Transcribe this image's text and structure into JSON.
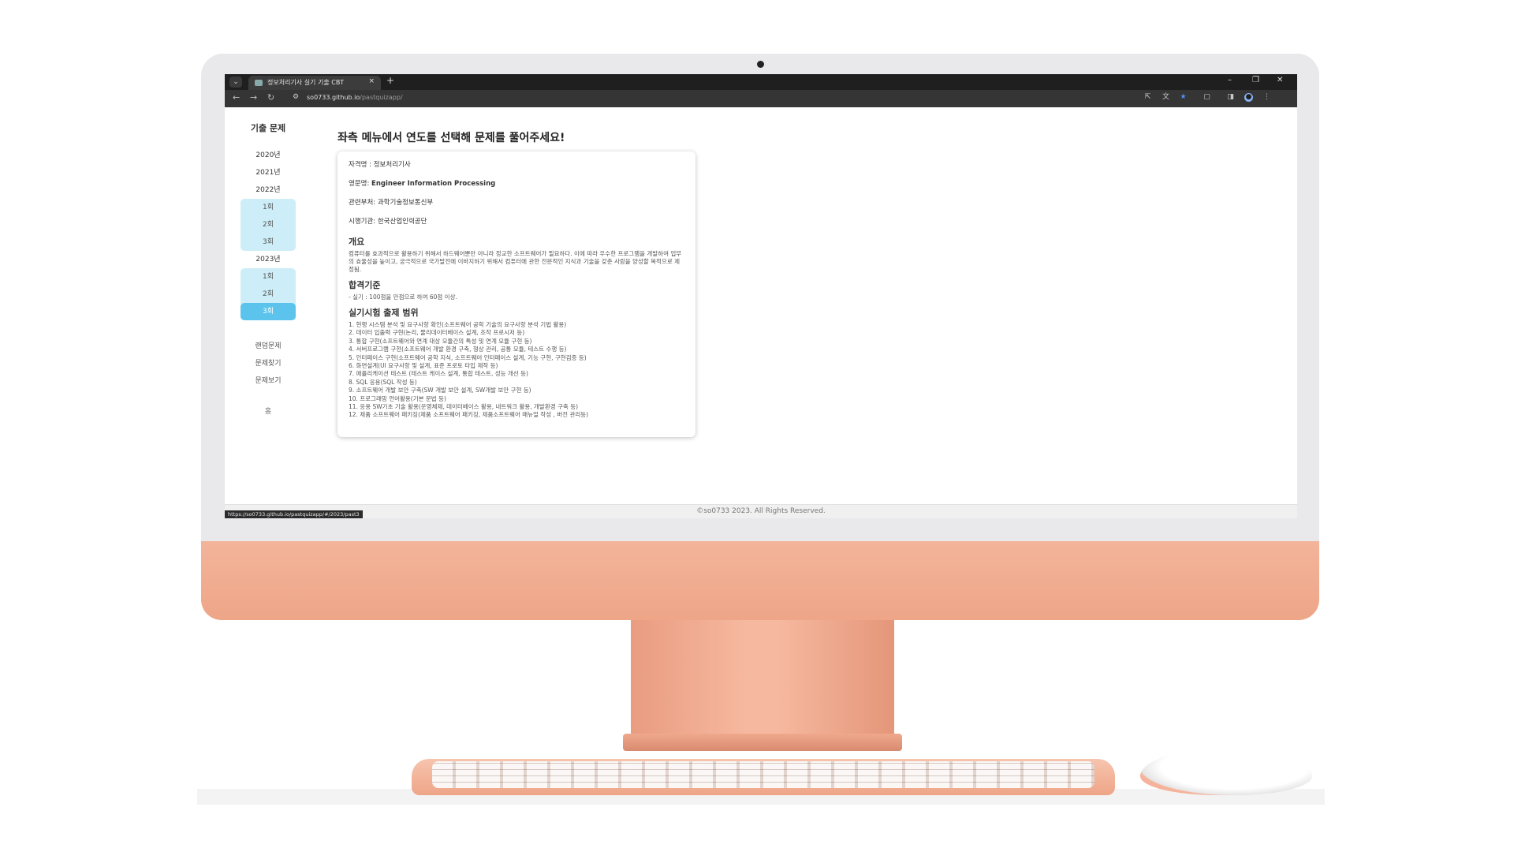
{
  "browser": {
    "tab_title": "정보처리기사 실기 기출 CBT",
    "new_tab": "+",
    "close_tab": "×",
    "url_host": "so0733.github.io",
    "url_path": "/pastquizapp/",
    "status_url": "https://so0733.github.io/pastquizapp/#/2023/past3"
  },
  "sidebar": {
    "title": "기출 문제",
    "year_2020": "2020년",
    "year_2021": "2021년",
    "year_2022": "2022년",
    "rounds_2022": [
      "1회",
      "2회",
      "3회"
    ],
    "year_2023": "2023년",
    "rounds_2023": [
      "1회",
      "2회",
      "3회"
    ],
    "active_round": "2023년 3회",
    "links": [
      "랜덤문제",
      "문제찾기",
      "문제보기"
    ],
    "home": "홈"
  },
  "main": {
    "heading": "좌측 메뉴에서 연도를 선택해 문제를 풀어주세요!",
    "info": {
      "qualification_label": "자격명 : ",
      "qualification": "정보처리기사",
      "english_label": "영문명: ",
      "english": "Engineer Information Processing",
      "ministry_label": "관련부처: ",
      "ministry": "과학기술정보통신부",
      "agency_label": "시행기관: ",
      "agency": "한국산업인력공단"
    },
    "overview_title": "개요",
    "overview_text": "컴퓨터를 효과적으로 활용하기 위해서 하드웨어뿐만 아니라 정교한 소프트웨어가 필요하다. 이에 따라 우수한 프로그램을 개발하여 업무의 효율성을 높이고, 궁극적으로 국가발전에 이바지하기 위해서 컴퓨터에 관한 전문적인 지식과 기술을 갖춘 사람을 양성할 목적으로 제정됨.",
    "pass_title": "합격기준",
    "pass_text": "- 실기 : 100점을 만점으로 하여 60점 이상.",
    "scope_title": "실기시험 출제 범위",
    "scope_items": [
      "1. 현행 시스템 분석 및 요구사항 확인(소프트웨어 공학 기술의 요구사항 분석 기법 활용)",
      "2. 데이터 입출력 구현(논리, 물리데이터베이스 설계, 조작 프로시저 등)",
      "3. 통합 구현(소프트웨어와 연계 대상 모듈간의 특성 및 연계 모듈 구현 등)",
      "4. 서버프로그램 구현(소프트웨어 개발 환경 구축, 형상 관리, 공통 모듈, 테스트 수행 등)",
      "5. 인터페이스 구현(소프트웨어 공학 지식, 소프트웨어 인터페이스 설계, 기능 구현, 구현검증 등)",
      "6. 화면설계(UI 요구사항 및 설계, 표준 프로토 타입 제작 등)",
      "7. 애플리케이션 테스트 (테스트 케이스 설계, 통합 테스트, 성능 개선 등)",
      "8. SQL 응용(SQL 작성 등)",
      "9. 소프트웨어 개발 보안 구축(SW 개발 보안 설계, SW개발 보안 구현 등)",
      "10. 프로그래밍 언어활용(기본 문법 등)",
      "11. 응용 SW기초 기술 활용(운영체제, 데이터베이스 활용, 네트워크 활용, 개발환경 구축 등)",
      "12. 제품 소프트웨어 패키징(제품 소프트웨어 패키징, 제품소프트웨어 매뉴얼 작성 , 버전 관리등)"
    ]
  },
  "footer": {
    "text": "©so0733 2023. All Rights Reserved."
  }
}
